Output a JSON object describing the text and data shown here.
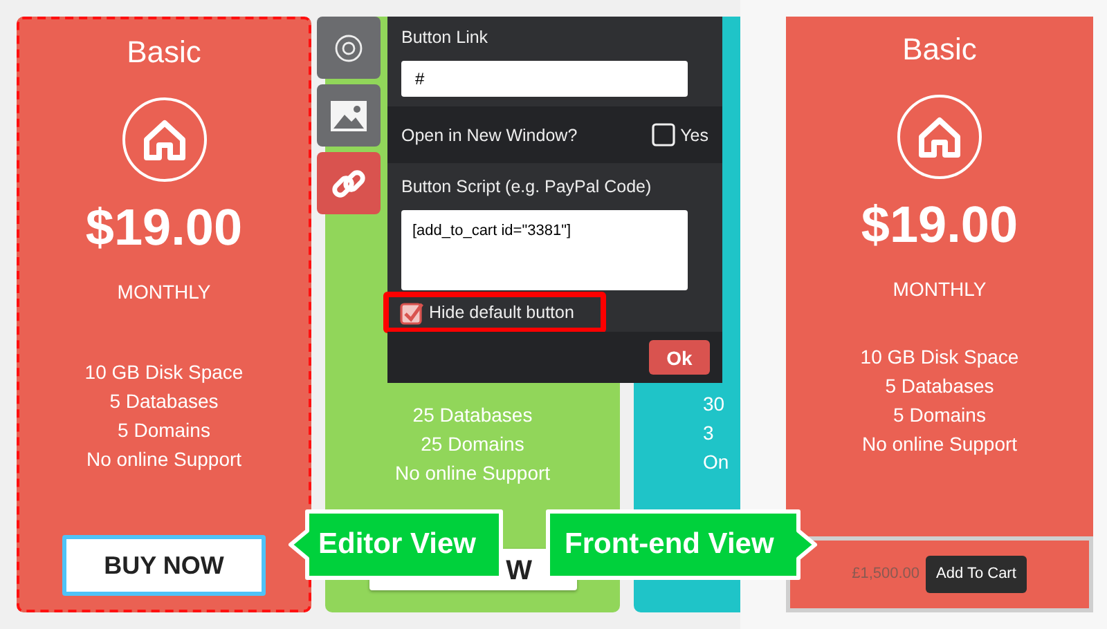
{
  "editor_cards": [
    {
      "color": "#ea6153",
      "selected": true,
      "title": "Basic",
      "price": "$19.00",
      "period": "MONTHLY",
      "features": [
        "10 GB Disk Space",
        "5 Databases",
        "5 Domains",
        "No online Support"
      ],
      "button": "BUY NOW"
    },
    {
      "color": "#91d65a",
      "selected": false,
      "features": [
        "25 Databases",
        "25 Domains",
        "No online Support"
      ],
      "button": "W"
    },
    {
      "color": "#1fc4c8",
      "selected": false,
      "features": [
        "30",
        "3",
        "On"
      ]
    }
  ],
  "toolbar": [
    {
      "kind": "gear",
      "selected": false
    },
    {
      "kind": "image",
      "selected": false
    },
    {
      "kind": "link",
      "selected": true
    }
  ],
  "settings_panel": {
    "link_label": "Button Link",
    "link_value": "#",
    "new_window_label": "Open in New Window?",
    "new_window_checked": false,
    "new_window_option": "Yes",
    "script_label": "Button Script (e.g. PayPal Code)",
    "script_value": "[add_to_cart id=\"3381\"]",
    "hide_default_label": "Hide default button",
    "hide_default_checked": true,
    "hide_default_highlighted": true,
    "ok": "Ok"
  },
  "callouts": [
    {
      "text": "Editor View",
      "kind": "left"
    },
    {
      "text": "Front-end View",
      "kind": "right"
    }
  ],
  "front_end_card": {
    "color": "#ea6153",
    "title": "Basic",
    "price": "$19.00",
    "period": "MONTHLY",
    "features": [
      "10 GB Disk Space",
      "5 Databases",
      "5 Domains",
      "No online Support"
    ],
    "amount": "£1,500.00",
    "button": "Add To Cart"
  }
}
